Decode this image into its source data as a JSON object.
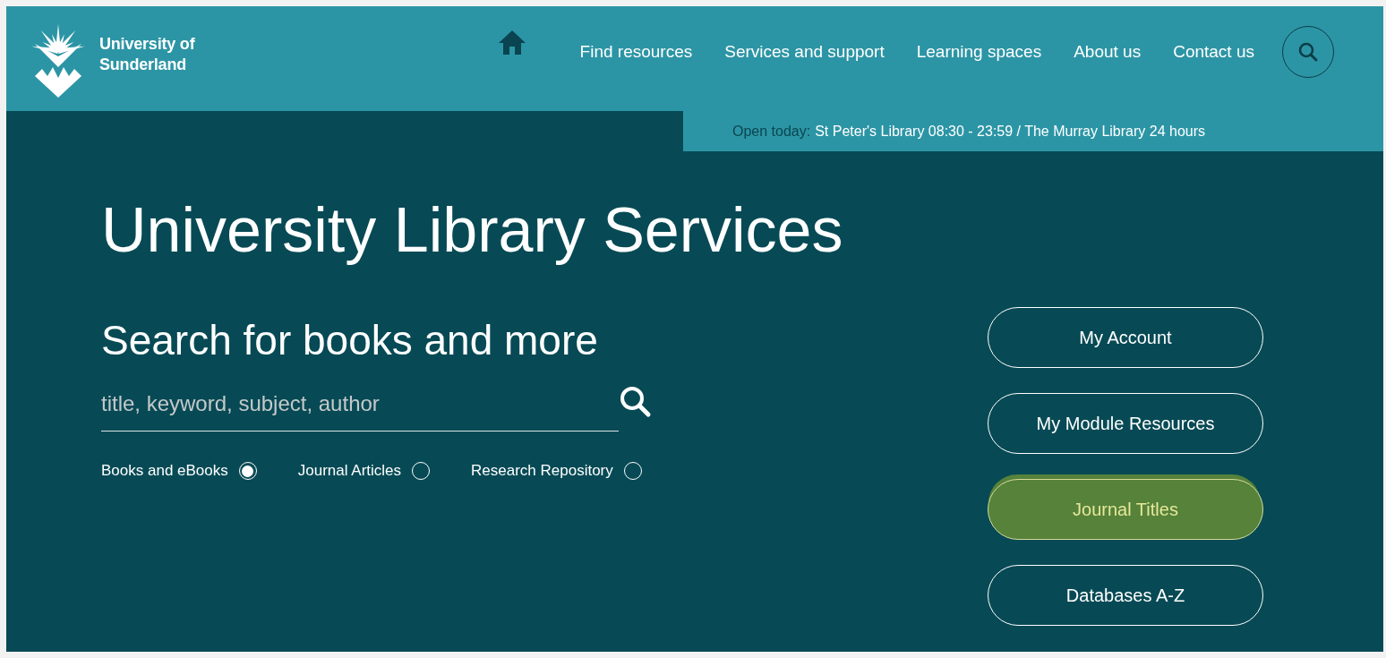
{
  "header": {
    "logo_lines": [
      "University of",
      "Sunderland"
    ],
    "nav": [
      {
        "kind": "home"
      },
      {
        "kind": "link",
        "label": "Find resources"
      },
      {
        "kind": "link",
        "label": "Services and support"
      },
      {
        "kind": "link",
        "label": "Learning spaces"
      },
      {
        "kind": "link",
        "label": "About us"
      },
      {
        "kind": "link",
        "label": "Contact us"
      },
      {
        "kind": "search"
      }
    ]
  },
  "opening_hours": {
    "label": "Open today:",
    "text": "St Peter's Library 08:30 - 23:59 / The Murray Library 24 hours"
  },
  "title": "University Library Services",
  "search": {
    "heading": "Search for books and more",
    "placeholder": "title, keyword, subject, author",
    "options": [
      {
        "label": "Books and eBooks",
        "selected": true
      },
      {
        "label": "Journal Articles",
        "selected": false
      },
      {
        "label": "Research Repository",
        "selected": false
      }
    ]
  },
  "quick_links": [
    {
      "label": "My Account",
      "focused": false
    },
    {
      "label": "My Module Resources",
      "focused": false
    },
    {
      "label": "Journal Titles",
      "focused": true
    },
    {
      "label": "Databases A-Z",
      "focused": false
    }
  ]
}
